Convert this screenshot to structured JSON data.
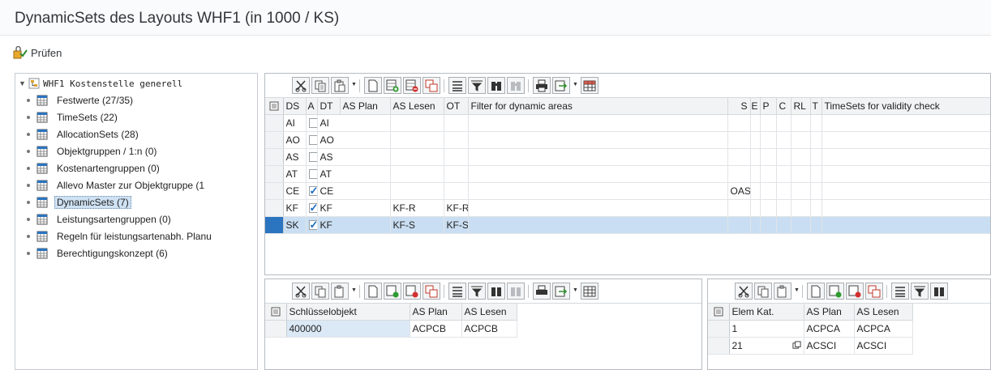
{
  "window": {
    "title": "DynamicSets des Layouts WHF1 (in 1000 / KS)"
  },
  "toolbar": {
    "check_label": "Prüfen"
  },
  "tree": {
    "root_label": "WHF1 Kostenstelle generell",
    "items": [
      {
        "label": "Festwerte (27/35)"
      },
      {
        "label": "TimeSets (22)"
      },
      {
        "label": "AllocationSets (28)"
      },
      {
        "label": "Objektgruppen / 1:n (0)"
      },
      {
        "label": "Kostenartengruppen (0)"
      },
      {
        "label": "Allevo Master zur Objektgruppe (1"
      },
      {
        "label": "DynamicSets (7)"
      },
      {
        "label": "Leistungsartengruppen (0)"
      },
      {
        "label": "Regeln für leistungsartenabh. Planu"
      },
      {
        "label": "Berechtigungskonzept (6)"
      }
    ],
    "selected_index": 6
  },
  "main_grid": {
    "columns": [
      "DS",
      "A",
      "DT",
      "AS Plan",
      "AS Lesen",
      "OT",
      "Filter for dynamic areas",
      "S",
      "E",
      "P",
      "C",
      "RL",
      "T",
      "TimeSets for validity check"
    ],
    "rows": [
      {
        "ds": "AI",
        "a": false,
        "dt": "AI",
        "as_plan": "",
        "as_lesen": "",
        "ot": "",
        "filter": ""
      },
      {
        "ds": "AO",
        "a": false,
        "dt": "AO",
        "as_plan": "",
        "as_lesen": "",
        "ot": "",
        "filter": ""
      },
      {
        "ds": "AS",
        "a": false,
        "dt": "AS",
        "as_plan": "",
        "as_lesen": "",
        "ot": "",
        "filter": ""
      },
      {
        "ds": "AT",
        "a": false,
        "dt": "AT",
        "as_plan": "",
        "as_lesen": "",
        "ot": "",
        "filter": ""
      },
      {
        "ds": "CE",
        "a": true,
        "dt": "CE",
        "as_plan": "",
        "as_lesen": "",
        "ot": "",
        "filter": "OAS_MAT"
      },
      {
        "ds": "KF",
        "a": true,
        "dt": "KF",
        "as_plan": "KF-R",
        "as_lesen": "KF-R",
        "ot": "",
        "filter": ""
      },
      {
        "ds": "SK",
        "a": true,
        "dt": "KF",
        "as_plan": "KF-S",
        "as_lesen": "KF-S",
        "ot": "",
        "filter": ""
      }
    ],
    "selected_row": 6
  },
  "key_grid": {
    "columns": [
      "Schlüsselobjekt",
      "AS Plan",
      "AS Lesen"
    ],
    "rows": [
      {
        "key": "400000",
        "as_plan": "ACPCB",
        "as_lesen": "ACPCB"
      }
    ]
  },
  "elem_grid": {
    "columns": [
      "Elem Kat.",
      "AS Plan",
      "AS Lesen"
    ],
    "rows": [
      {
        "elem": "1",
        "as_plan": "ACPCA",
        "as_lesen": "ACPCA"
      },
      {
        "elem": "21",
        "as_plan": "ACSCI",
        "as_lesen": "ACSCI"
      }
    ]
  },
  "colors": {
    "accent": "#2b74bf",
    "selection": "#c9def2",
    "check": "#1a6cc0"
  }
}
